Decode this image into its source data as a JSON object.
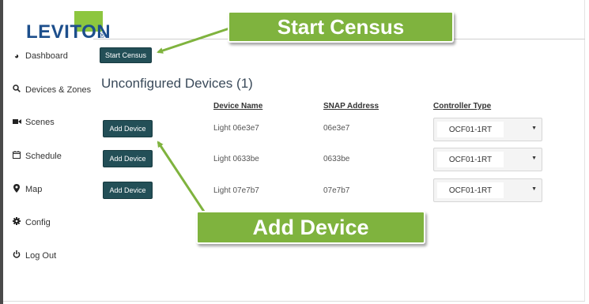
{
  "brand": {
    "logo_text": "LEVITON",
    "green": "#8dc63f",
    "blue": "#1d4f8c"
  },
  "sidebar": {
    "items": [
      {
        "label": "Dashboard",
        "icon": "dashboard-icon",
        "glyph": "◕"
      },
      {
        "label": "Devices & Zones",
        "icon": "search-icon",
        "glyph": "🔍︎"
      },
      {
        "label": "Scenes",
        "icon": "video-camera-icon",
        "glyph": "■"
      },
      {
        "label": "Schedule",
        "icon": "calendar-icon",
        "glyph": "▦"
      },
      {
        "label": "Map",
        "icon": "map-marker-icon",
        "glyph": "⬤"
      },
      {
        "label": "Config",
        "icon": "gear-icon",
        "glyph": "✹"
      },
      {
        "label": "Log Out",
        "icon": "power-icon",
        "glyph": "⏻"
      }
    ]
  },
  "main": {
    "start_census_label": "Start Census",
    "title": "Unconfigured Devices (1)",
    "columns": [
      "Device Name",
      "SNAP Address",
      "Controller Type"
    ],
    "rows": [
      {
        "action": "Add Device",
        "name": "Light 06e3e7",
        "address": "06e3e7",
        "controller": "OCF01-1RT"
      },
      {
        "action": "Add Device",
        "name": "Light 0633be",
        "address": "0633be",
        "controller": "OCF01-1RT"
      },
      {
        "action": "Add Device",
        "name": "Light 07e7b7",
        "address": "07e7b7",
        "controller": "OCF01-1RT"
      }
    ]
  },
  "callouts": {
    "start_census": "Start Census",
    "add_device": "Add Device",
    "color": "#7fb33e"
  }
}
